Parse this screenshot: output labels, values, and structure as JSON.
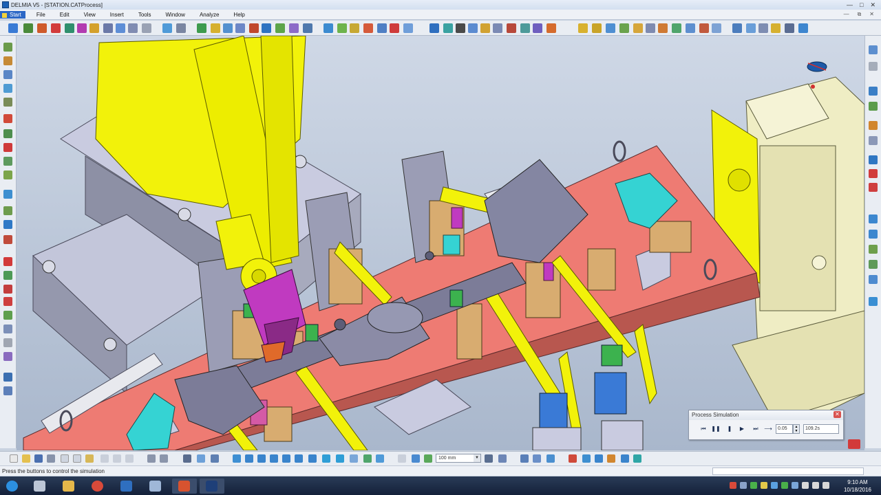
{
  "window": {
    "title": "DELMIA V5 - [STATION.CATProcess]"
  },
  "menu": {
    "items": [
      "Start",
      "File",
      "Edit",
      "View",
      "Insert",
      "Tools",
      "Window",
      "Analyze",
      "Help"
    ]
  },
  "simulation_panel": {
    "title": "Process Simulation",
    "step": "0.05",
    "time": "109.2s"
  },
  "units": {
    "value": "100 mm"
  },
  "status": {
    "message": "Press the buttons to control the simulation"
  },
  "clock": {
    "time": "9:10 AM",
    "date": "10/18/2016"
  },
  "colors": {
    "robot": "#f2f20a",
    "base_plate": "#ee7b73",
    "part": "#7c7c98",
    "fixture_frame": "#efedc4",
    "gripper": "#c03ac0",
    "clamp_block": "#d8ac70",
    "highlight_cyan": "#35d3d3"
  }
}
